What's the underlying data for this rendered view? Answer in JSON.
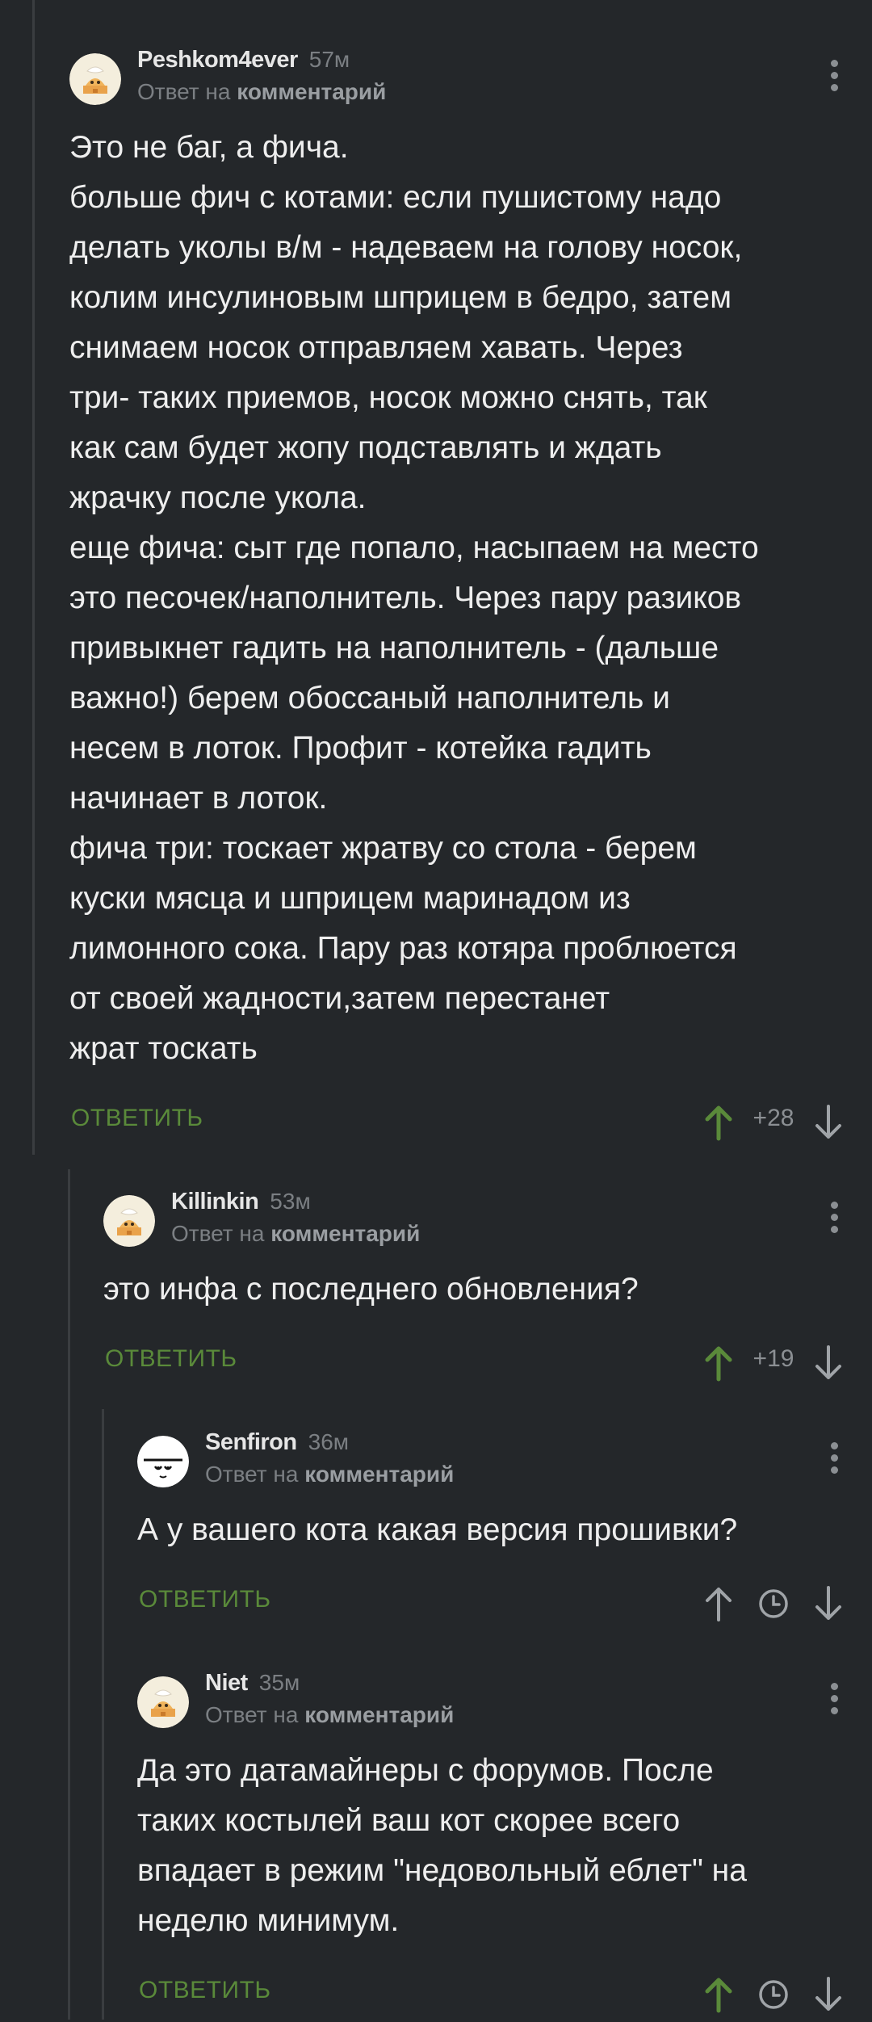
{
  "colors": {
    "background": "#24272a",
    "reply_action": "#5a8a3a",
    "upvote_active": "#5a8a3a",
    "muted": "#7b7f83"
  },
  "comments": [
    {
      "author": "Peshkom4ever",
      "time": "57м",
      "reply_prefix": "Ответ на",
      "reply_target": "комментарий",
      "avatar": "cat-avatar",
      "body_lines": [
        "Это не баг, а фича.",
        "больше фич с котами: если пушистому надо",
        "делать уколы в/м - надеваем на голову носок,",
        "колим инсулиновым шприцем в бедро, затем",
        "снимаем носок отправляем хавать. Через",
        "три- таких приемов, носок можно снять, так",
        "как сам будет жопу подставлять и ждать",
        "жрачку после укола.",
        "еще фича: сыт где попало, насыпаем на место",
        "это песочек/наполнитель. Через пару разиков",
        "привыкнет гадить на наполнитель - (дальше",
        "важно!) берем обоссаный наполнитель и",
        "несем в лоток. Профит - котейка гадить",
        "начинает в лоток.",
        "фича три: тоскает жратву со стола - берем",
        "куски мясца и шприцем маринадом из",
        "лимонного сока. Пару раз котяра проблюется",
        "от своей жадности,затем перестанет",
        "жрат тоскать"
      ],
      "reply_label": "ОТВЕТИТЬ",
      "rating": "+28",
      "upvoted": true
    },
    {
      "author": "Killinkin",
      "time": "53м",
      "reply_prefix": "Ответ на",
      "reply_target": "комментарий",
      "avatar": "cat-avatar",
      "body_lines": [
        "это инфа с последнего обновления?"
      ],
      "reply_label": "ОТВЕТИТЬ",
      "rating": "+19",
      "upvoted": true
    },
    {
      "author": "Senfiron",
      "time": "36м",
      "reply_prefix": "Ответ на",
      "reply_target": "комментарий",
      "avatar": "face-avatar",
      "body_lines": [
        "А у вашего кота какая версия прошивки?"
      ],
      "reply_label": "ОТВЕТИТЬ",
      "rating": "",
      "upvoted": false,
      "rating_hidden": true
    },
    {
      "author": "Niet",
      "time": "35м",
      "reply_prefix": "Ответ на",
      "reply_target": "комментарий",
      "avatar": "cat-avatar",
      "body_lines": [
        "Да это датамайнеры с форумов. После",
        "таких костылей ваш кот скорее всего",
        "впадает в режим \"недовольный еблет\" на",
        "неделю минимум."
      ],
      "reply_label": "ОТВЕТИТЬ",
      "rating": "",
      "upvoted": true,
      "rating_hidden": true
    }
  ]
}
